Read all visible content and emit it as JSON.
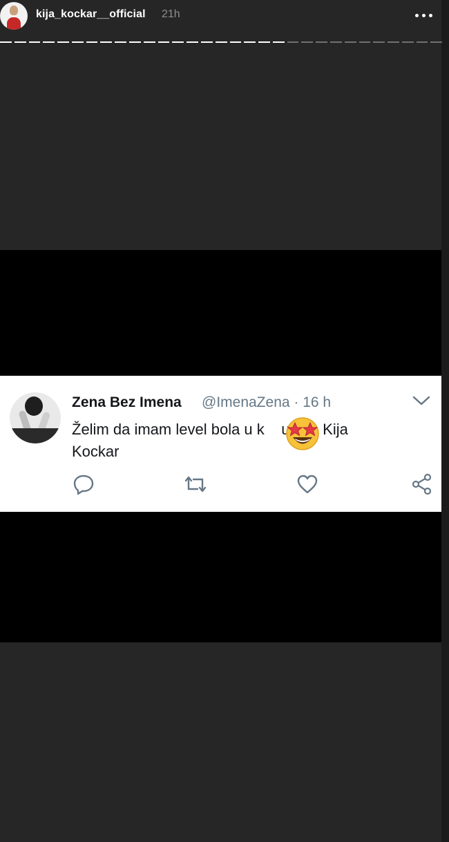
{
  "header": {
    "username": "kija_kockar__official",
    "time": "21h"
  },
  "progress": {
    "total_segments": 31,
    "completed_segments": 20
  },
  "tweet": {
    "display_name": "Zena Bez Imena",
    "handle_time": "@ImenaZena · 16 h",
    "text_line1": "Želim da imam level bola u k    u kao Kija",
    "text_line2": "Kockar",
    "emoji_icon": "star-struck-emoji"
  },
  "colors": {
    "background": "#262626",
    "band": "#000000",
    "card": "#ffffff",
    "handle": "#657786",
    "icon": "#657786",
    "emoji_yellow": "#f7c23a"
  }
}
